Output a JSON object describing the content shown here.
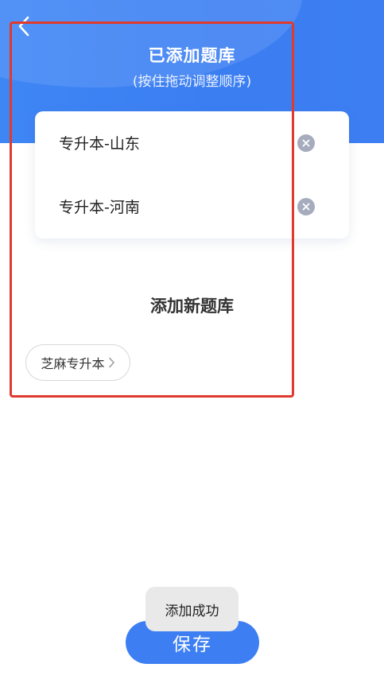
{
  "header": {
    "title": "已添加题库",
    "subtitle": "(按住拖动调整顺序)",
    "back_icon": "chevron-left-icon"
  },
  "added_banks": [
    {
      "name": "专升本-山东",
      "remove_icon": "close-circle-icon"
    },
    {
      "name": "专升本-河南",
      "remove_icon": "close-circle-icon"
    }
  ],
  "add_section": {
    "title": "添加新题库",
    "chips": [
      {
        "label": "芝麻专升本",
        "icon": "chevron-right-icon"
      }
    ]
  },
  "footer": {
    "save_label": "保存"
  },
  "toast": {
    "text": "添加成功"
  },
  "colors": {
    "accent": "#3d7ff3",
    "highlight": "#e03a2d",
    "remove_icon_bg": "#a6abbd"
  }
}
